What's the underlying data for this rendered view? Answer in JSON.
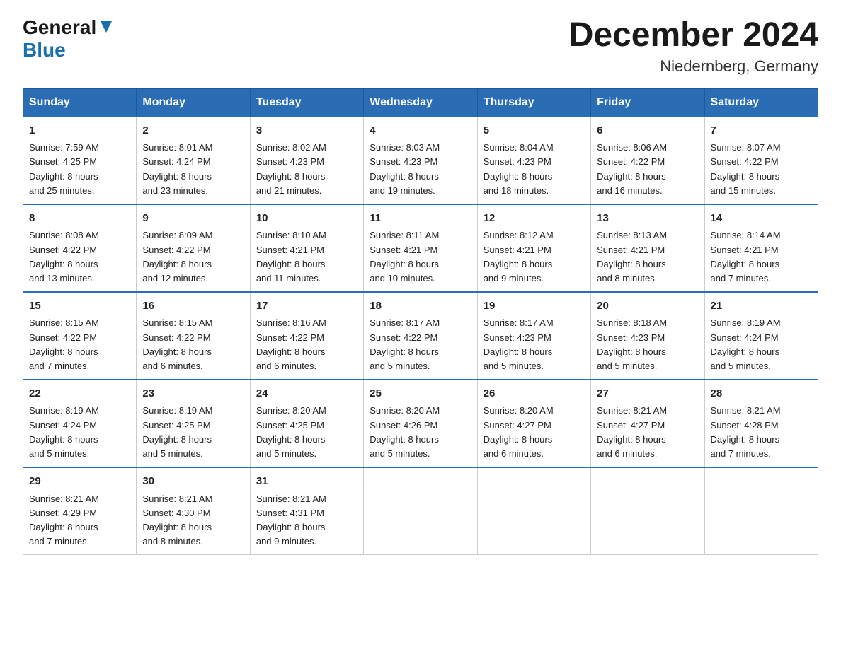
{
  "header": {
    "logo_general": "General",
    "logo_blue": "Blue",
    "month_title": "December 2024",
    "location": "Niedernberg, Germany"
  },
  "weekdays": [
    "Sunday",
    "Monday",
    "Tuesday",
    "Wednesday",
    "Thursday",
    "Friday",
    "Saturday"
  ],
  "weeks": [
    [
      {
        "day": "1",
        "sunrise": "7:59 AM",
        "sunset": "4:25 PM",
        "daylight": "8 hours and 25 minutes."
      },
      {
        "day": "2",
        "sunrise": "8:01 AM",
        "sunset": "4:24 PM",
        "daylight": "8 hours and 23 minutes."
      },
      {
        "day": "3",
        "sunrise": "8:02 AM",
        "sunset": "4:23 PM",
        "daylight": "8 hours and 21 minutes."
      },
      {
        "day": "4",
        "sunrise": "8:03 AM",
        "sunset": "4:23 PM",
        "daylight": "8 hours and 19 minutes."
      },
      {
        "day": "5",
        "sunrise": "8:04 AM",
        "sunset": "4:23 PM",
        "daylight": "8 hours and 18 minutes."
      },
      {
        "day": "6",
        "sunrise": "8:06 AM",
        "sunset": "4:22 PM",
        "daylight": "8 hours and 16 minutes."
      },
      {
        "day": "7",
        "sunrise": "8:07 AM",
        "sunset": "4:22 PM",
        "daylight": "8 hours and 15 minutes."
      }
    ],
    [
      {
        "day": "8",
        "sunrise": "8:08 AM",
        "sunset": "4:22 PM",
        "daylight": "8 hours and 13 minutes."
      },
      {
        "day": "9",
        "sunrise": "8:09 AM",
        "sunset": "4:22 PM",
        "daylight": "8 hours and 12 minutes."
      },
      {
        "day": "10",
        "sunrise": "8:10 AM",
        "sunset": "4:21 PM",
        "daylight": "8 hours and 11 minutes."
      },
      {
        "day": "11",
        "sunrise": "8:11 AM",
        "sunset": "4:21 PM",
        "daylight": "8 hours and 10 minutes."
      },
      {
        "day": "12",
        "sunrise": "8:12 AM",
        "sunset": "4:21 PM",
        "daylight": "8 hours and 9 minutes."
      },
      {
        "day": "13",
        "sunrise": "8:13 AM",
        "sunset": "4:21 PM",
        "daylight": "8 hours and 8 minutes."
      },
      {
        "day": "14",
        "sunrise": "8:14 AM",
        "sunset": "4:21 PM",
        "daylight": "8 hours and 7 minutes."
      }
    ],
    [
      {
        "day": "15",
        "sunrise": "8:15 AM",
        "sunset": "4:22 PM",
        "daylight": "8 hours and 7 minutes."
      },
      {
        "day": "16",
        "sunrise": "8:15 AM",
        "sunset": "4:22 PM",
        "daylight": "8 hours and 6 minutes."
      },
      {
        "day": "17",
        "sunrise": "8:16 AM",
        "sunset": "4:22 PM",
        "daylight": "8 hours and 6 minutes."
      },
      {
        "day": "18",
        "sunrise": "8:17 AM",
        "sunset": "4:22 PM",
        "daylight": "8 hours and 5 minutes."
      },
      {
        "day": "19",
        "sunrise": "8:17 AM",
        "sunset": "4:23 PM",
        "daylight": "8 hours and 5 minutes."
      },
      {
        "day": "20",
        "sunrise": "8:18 AM",
        "sunset": "4:23 PM",
        "daylight": "8 hours and 5 minutes."
      },
      {
        "day": "21",
        "sunrise": "8:19 AM",
        "sunset": "4:24 PM",
        "daylight": "8 hours and 5 minutes."
      }
    ],
    [
      {
        "day": "22",
        "sunrise": "8:19 AM",
        "sunset": "4:24 PM",
        "daylight": "8 hours and 5 minutes."
      },
      {
        "day": "23",
        "sunrise": "8:19 AM",
        "sunset": "4:25 PM",
        "daylight": "8 hours and 5 minutes."
      },
      {
        "day": "24",
        "sunrise": "8:20 AM",
        "sunset": "4:25 PM",
        "daylight": "8 hours and 5 minutes."
      },
      {
        "day": "25",
        "sunrise": "8:20 AM",
        "sunset": "4:26 PM",
        "daylight": "8 hours and 5 minutes."
      },
      {
        "day": "26",
        "sunrise": "8:20 AM",
        "sunset": "4:27 PM",
        "daylight": "8 hours and 6 minutes."
      },
      {
        "day": "27",
        "sunrise": "8:21 AM",
        "sunset": "4:27 PM",
        "daylight": "8 hours and 6 minutes."
      },
      {
        "day": "28",
        "sunrise": "8:21 AM",
        "sunset": "4:28 PM",
        "daylight": "8 hours and 7 minutes."
      }
    ],
    [
      {
        "day": "29",
        "sunrise": "8:21 AM",
        "sunset": "4:29 PM",
        "daylight": "8 hours and 7 minutes."
      },
      {
        "day": "30",
        "sunrise": "8:21 AM",
        "sunset": "4:30 PM",
        "daylight": "8 hours and 8 minutes."
      },
      {
        "day": "31",
        "sunrise": "8:21 AM",
        "sunset": "4:31 PM",
        "daylight": "8 hours and 9 minutes."
      },
      null,
      null,
      null,
      null
    ]
  ],
  "labels": {
    "sunrise": "Sunrise:",
    "sunset": "Sunset:",
    "daylight": "Daylight:"
  }
}
